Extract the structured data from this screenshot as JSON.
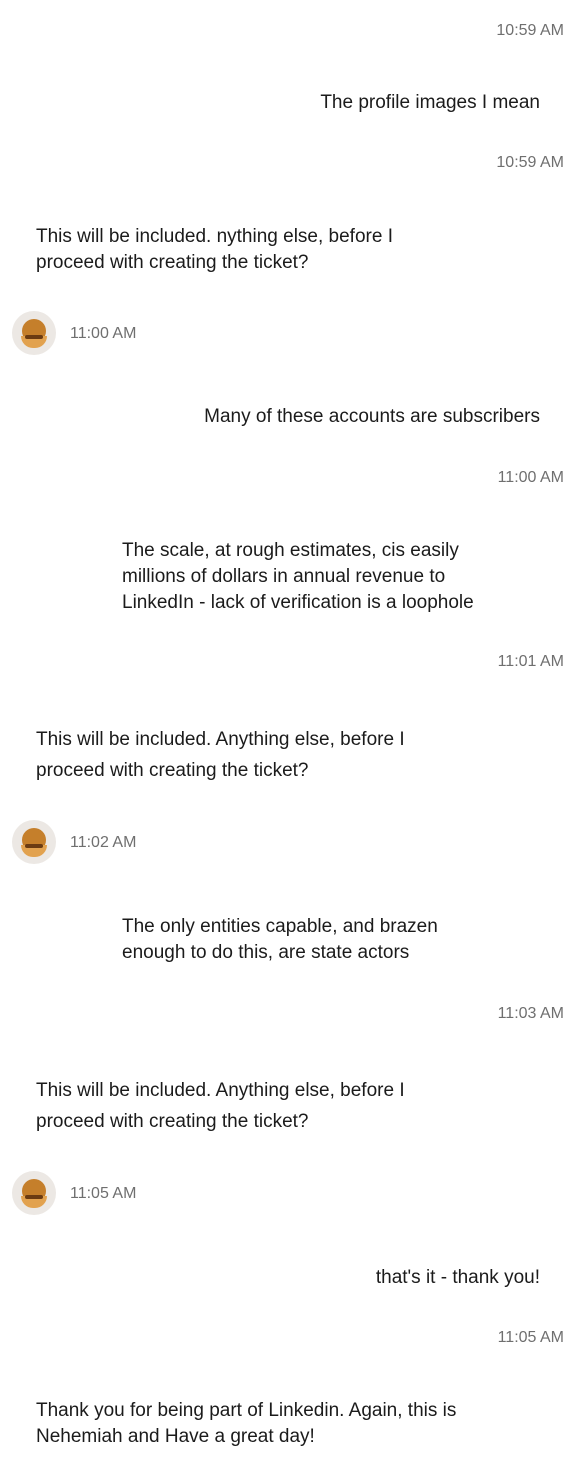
{
  "messages": [
    {
      "type": "time",
      "text": "10:59 AM"
    },
    {
      "type": "user",
      "text": "The profile images I mean"
    },
    {
      "type": "time",
      "text": "10:59 AM"
    },
    {
      "type": "agent",
      "text": "This will be included. nything else, before I proceed with creating the ticket?"
    },
    {
      "type": "agent-time",
      "text": "11:00 AM"
    },
    {
      "type": "user",
      "text": "Many of these accounts are subscribers"
    },
    {
      "type": "time",
      "text": "11:00 AM"
    },
    {
      "type": "user",
      "text": "The scale, at rough estimates, cis easily millions of dollars in annual revenue to LinkedIn - lack of verification is a loophole"
    },
    {
      "type": "time",
      "text": "11:01 AM"
    },
    {
      "type": "agent",
      "text": "This will be included. Anything else, before I proceed with creating the ticket?"
    },
    {
      "type": "agent-time",
      "text": "11:02 AM"
    },
    {
      "type": "user",
      "text": "The only entities capable, and brazen enough to do this, are state actors"
    },
    {
      "type": "time",
      "text": "11:03 AM"
    },
    {
      "type": "agent",
      "text": "This will be included. Anything else, before I proceed with creating the ticket?"
    },
    {
      "type": "agent-time",
      "text": "11:05 AM"
    },
    {
      "type": "user",
      "text": "that's it - thank you!"
    },
    {
      "type": "time",
      "text": "11:05 AM"
    },
    {
      "type": "agent",
      "text": "Thank you for being part of Linkedin. Again, this is Nehemiah and Have a great day!"
    }
  ]
}
